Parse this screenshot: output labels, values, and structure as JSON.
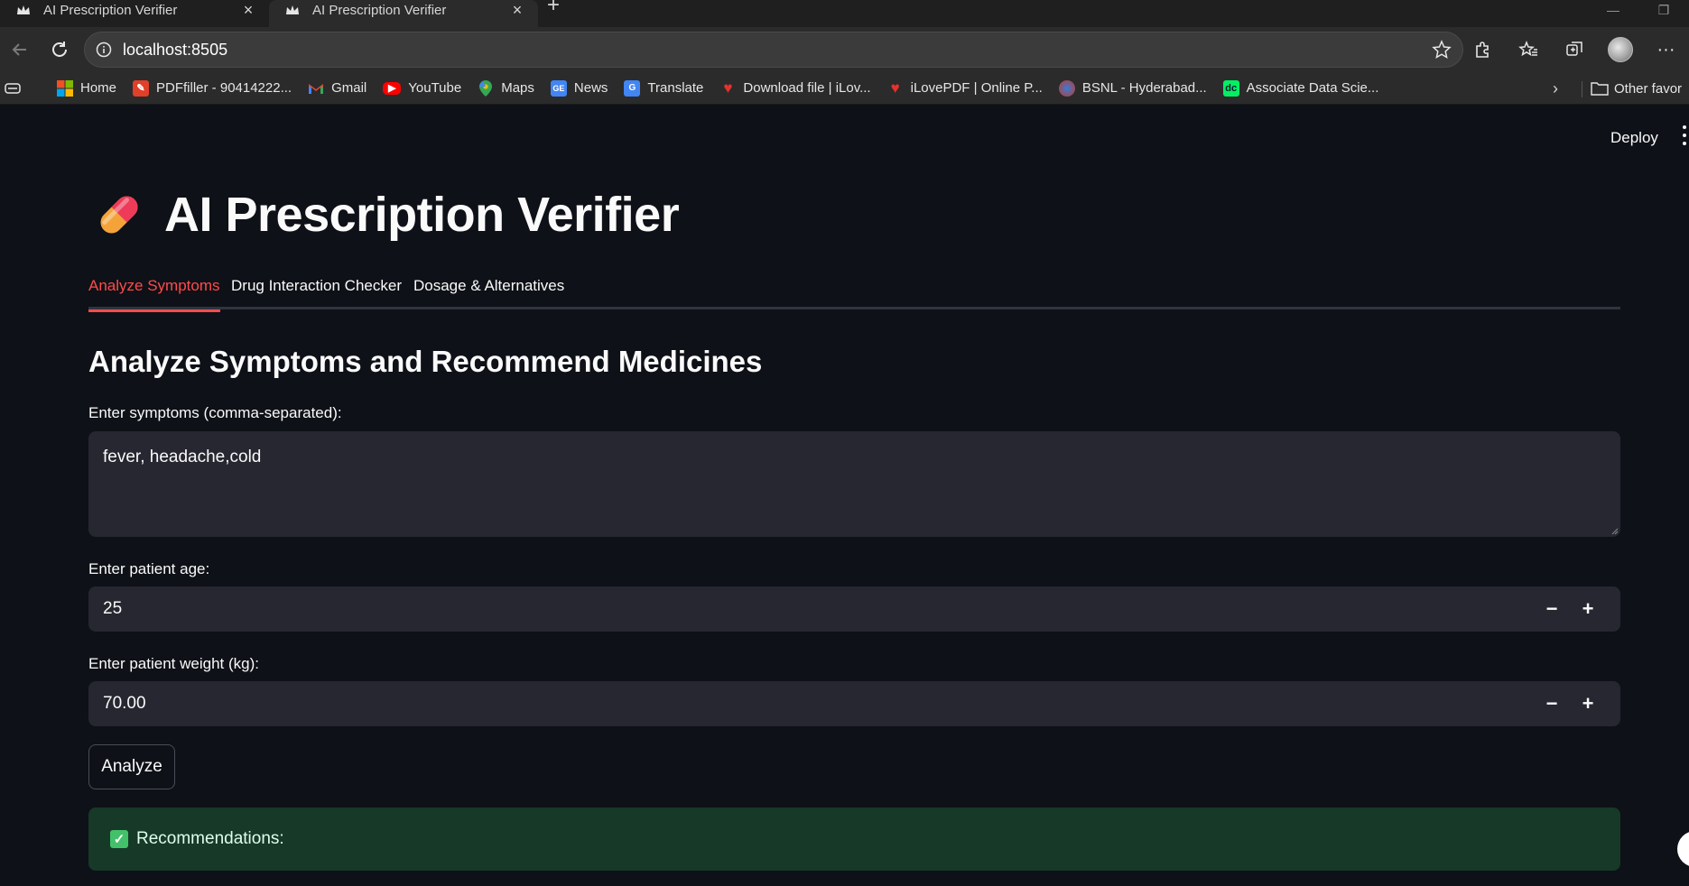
{
  "browser": {
    "tabs": [
      {
        "title": "AI Prescription Verifier",
        "active": false
      },
      {
        "title": "AI Prescription Verifier",
        "active": true
      }
    ],
    "url": "localhost:8505",
    "bookmarks": [
      {
        "label": "Home",
        "icon": "windows-logo-icon"
      },
      {
        "label": "PDFfiller - 90414222...",
        "icon": "pdffiller-icon"
      },
      {
        "label": "Gmail",
        "icon": "gmail-icon"
      },
      {
        "label": "YouTube",
        "icon": "youtube-icon"
      },
      {
        "label": "Maps",
        "icon": "maps-pin-icon"
      },
      {
        "label": "News",
        "icon": "news-icon"
      },
      {
        "label": "Translate",
        "icon": "translate-icon"
      },
      {
        "label": "Download file | iLov...",
        "icon": "ilovepdf-heart-icon"
      },
      {
        "label": "iLovePDF | Online P...",
        "icon": "ilovepdf-heart-icon"
      },
      {
        "label": "BSNL - Hyderabad...",
        "icon": "bsnl-icon"
      },
      {
        "label": "Associate Data Scie...",
        "icon": "datacamp-icon"
      }
    ],
    "other_favorites": "Other favor"
  },
  "app": {
    "deploy_label": "Deploy",
    "title": "AI Prescription Verifier",
    "title_icon": "pill-emoji",
    "tabs": [
      "Analyze Symptoms",
      "Drug Interaction Checker",
      "Dosage & Alternatives"
    ],
    "active_tab": "Analyze Symptoms",
    "section_title": "Analyze Symptoms and Recommend Medicines",
    "symptoms": {
      "label": "Enter symptoms (comma-separated):",
      "value": "fever, headache,cold"
    },
    "age": {
      "label": "Enter patient age:",
      "value": "25"
    },
    "weight": {
      "label": "Enter patient weight (kg):",
      "value": "70.00"
    },
    "stepper": {
      "minus": "−",
      "plus": "+"
    },
    "analyze_label": "Analyze",
    "result": {
      "icon": "✓",
      "text": "Recommendations:"
    }
  },
  "colors": {
    "accent": "#ff4b4b",
    "page_bg": "#0e1117",
    "input_bg": "#262730",
    "success_bg": "#173928",
    "success_icon": "#43c16a"
  }
}
